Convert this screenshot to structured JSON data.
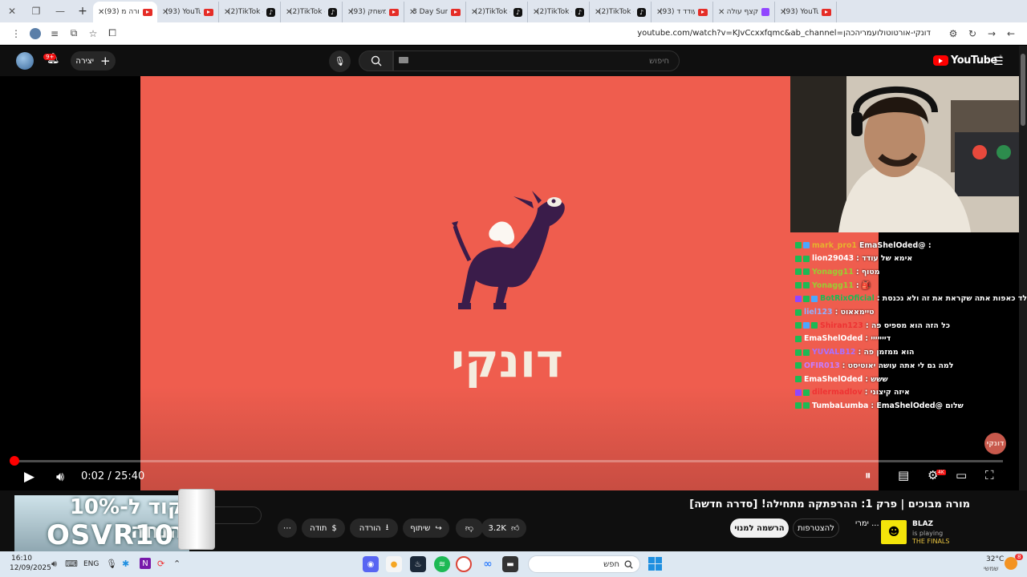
{
  "browser": {
    "tabs": [
      {
        "title": "(93) YouTub",
        "icon": "youtube-icon",
        "active": false
      },
      {
        "title": "קצף עולה",
        "icon": "twitch-icon",
        "active": false
      },
      {
        "title": "(93) עודד ד",
        "icon": "youtube-icon",
        "active": false
      },
      {
        "title": "(2)TikTok - ",
        "icon": "tiktok-icon",
        "active": false
      },
      {
        "title": "(2)TikTok - ",
        "icon": "tiktok-icon",
        "active": false
      },
      {
        "title": "(2)TikTok - ",
        "icon": "tiktok-icon",
        "active": false
      },
      {
        "title": "3 Day Survi",
        "icon": "youtube-icon",
        "active": false
      },
      {
        "title": "(93) משחק",
        "icon": "youtube-icon",
        "active": false
      },
      {
        "title": "(2)TikTok - ",
        "icon": "tiktok-icon",
        "active": false
      },
      {
        "title": "(2)TikTok - ",
        "icon": "tiktok-icon",
        "active": false
      },
      {
        "title": "(93) YouTub",
        "icon": "youtube-icon",
        "active": false
      },
      {
        "title": "(93) מורה מ",
        "icon": "youtube-icon",
        "active": true
      }
    ],
    "new_tab": "+",
    "url": "youtube.com/watch?v=KJvCcxxfqmc&ab_channel=דונקי-אורטוטולועמריהכהן"
  },
  "youtube": {
    "notification_count": "9+",
    "create_label": "יצירה",
    "search_placeholder": "חיפוש",
    "logo_text": "YouTube",
    "logo_region": "IL"
  },
  "video": {
    "logo_text": "דונקי",
    "watermark": "דונקי",
    "current_time": "0:02 / 25:40",
    "progress_fraction": 0.0013,
    "quality_badge": "4K",
    "title": "מורה מבוכים | פרק 1: ההרפתקה מתחילה! [סדרה חדשה]"
  },
  "chat": [
    {
      "user": "mark_pro1",
      "text": ": @EmaShelOded",
      "color": "#e6b12e",
      "badges": [
        "g",
        "b"
      ]
    },
    {
      "user": "lion29043",
      "text": "אימא של עודד :",
      "color": "#ffffff",
      "badges": [
        "g",
        "g"
      ]
    },
    {
      "user": "Yonagg11",
      "text": "מטוף :",
      "color": "#9acd32",
      "badges": [
        "g",
        "g"
      ]
    },
    {
      "user": "Yonagg11",
      "text": "🎒 :",
      "color": "#9acd32",
      "badges": [
        "g",
        "g"
      ]
    },
    {
      "user": "BotRixOficial",
      "text": "איזה ילד כאפות אתה שקראת את זה ולא נכנסת :",
      "color": "#1db954",
      "badges": [
        "p",
        "g",
        "b"
      ]
    },
    {
      "user": "liel123",
      "text": "טיימאאוט :",
      "color": "#8fb0ff",
      "badges": [
        "g"
      ]
    },
    {
      "user": "Shiran123",
      "text": "כל הזה הוא מספיס פה :",
      "color": "#e33",
      "badges": [
        "g",
        "b",
        "g"
      ]
    },
    {
      "user": "EmaShelOded",
      "text": "דייייייי :",
      "color": "#ffffff",
      "badges": [
        "g"
      ]
    },
    {
      "user": "YUVALB12",
      "text": "הוא ממזמן פה :",
      "color": "#a970ff",
      "badges": [
        "g",
        "g"
      ]
    },
    {
      "user": "OFIR013",
      "text": "למה גם לי אתה עושה יאוטיסט :",
      "color": "#c77dff",
      "badges": [
        "g"
      ]
    },
    {
      "user": "EmaShelOded",
      "text": "ששש :",
      "color": "#ffffff",
      "badges": [
        "g"
      ]
    },
    {
      "user": "dilermadlov",
      "text": "איזה קיצוני :",
      "color": "#e33",
      "badges": [
        "p",
        "g"
      ]
    },
    {
      "user": "TumbaLumba",
      "text": "שלום @EmaShelOded :",
      "color": "#ffffff",
      "badges": [
        "g",
        "g"
      ]
    }
  ],
  "actions": {
    "likes": "3.2K",
    "share": "שיתוף",
    "download": "הורדה",
    "thanks": "תודה",
    "more": "⋯"
  },
  "channel": {
    "join": "להצטרפות",
    "subscribe": "הרשמה למנוי",
    "name_partial": "ימרי ...",
    "game_name": "BLAZ",
    "game_status": "is playing",
    "game_title": "THE FINALS"
  },
  "promo": {
    "line1": "קוד ל-10% הנחה",
    "line2": "OSVR10"
  },
  "taskbar": {
    "time": "16:10",
    "date": "12/09/2025",
    "lang": "ENG",
    "search_placeholder": "חפש",
    "temp": "32°C",
    "weather_desc": "שמשי",
    "weather_badge": "8"
  }
}
